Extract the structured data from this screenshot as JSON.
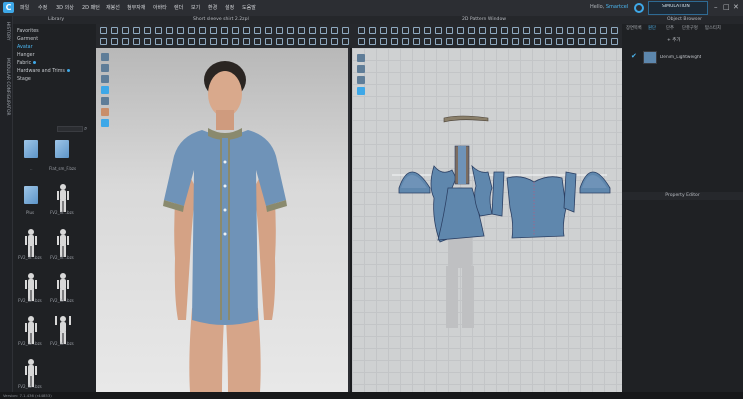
{
  "menubar": {
    "items": [
      "파일",
      "수정",
      "3D 의상",
      "2D 패턴",
      "재봉선",
      "첨부자재",
      "아바타",
      "렌더",
      "보기",
      "환경",
      "설정",
      "도움말"
    ],
    "greeting_prefix": "Hello,",
    "user": "Smartcel",
    "simulation_label": "SIMULATION"
  },
  "titles": {
    "library": "Library",
    "viewport3d": "Short sleeve shirt 2.2zpl",
    "viewport2d": "2D Pattern Window",
    "object_browser": "Object Browser",
    "property_editor": "Property Editor"
  },
  "vertical_tabs": [
    "HISTORY",
    "MODULAR CONFIGURATOR"
  ],
  "library": {
    "items": [
      {
        "label": "Favorites",
        "dot": false
      },
      {
        "label": "Garment",
        "dot": false
      },
      {
        "label": "Avatar",
        "dot": false
      },
      {
        "label": "Hanger",
        "dot": false
      },
      {
        "label": "Fabric",
        "dot": true
      },
      {
        "label": "Hardware and Trims",
        "dot": true
      },
      {
        "label": "Stage",
        "dot": false
      }
    ],
    "thumbnails": [
      {
        "label": "..",
        "type": "folder"
      },
      {
        "label": "Flat_sm_F.bzs",
        "type": "folder"
      },
      {
        "label": "Plus",
        "type": "folder"
      },
      {
        "label": "FV2_in...bzs",
        "type": "figure"
      },
      {
        "label": "FV2_in...bzs",
        "type": "figure"
      },
      {
        "label": "FV2_in...bzs",
        "type": "figure"
      },
      {
        "label": "FV2_in...bzs",
        "type": "figure"
      },
      {
        "label": "FV2_in...bzs",
        "type": "figure"
      },
      {
        "label": "FV2_in...bzs",
        "type": "figure"
      },
      {
        "label": "FV2_in...bzs",
        "type": "figure"
      },
      {
        "label": "FV2_in...bzs",
        "type": "figure"
      }
    ]
  },
  "object_browser": {
    "tabs": [
      "장면목록",
      "원단",
      "단추",
      "단춧구멍",
      "탑스티치"
    ],
    "active_tab": "원단",
    "add_label": "+ 추가",
    "fabric_name": "Denim_Lightweight"
  },
  "status": {
    "version": "Version: 7.1.436 (r44853)"
  },
  "colors": {
    "accent": "#3ea8e8",
    "shirt": "#6f93b8",
    "pattern_fill": "#5f87ad"
  }
}
